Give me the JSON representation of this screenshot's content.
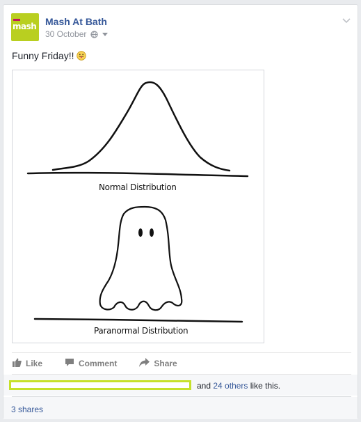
{
  "post": {
    "page_name": "Mash At Bath",
    "date": "30 October",
    "avatar_text": "mash",
    "text": "Funny Friday!!",
    "emoji": "tongue-out-emoji",
    "image": {
      "caption_top": "Normal Distribution",
      "caption_bottom": "Paranormal Distribution"
    }
  },
  "actions": {
    "like": "Like",
    "comment": "Comment",
    "share": "Share"
  },
  "likes": {
    "and_text": "and",
    "others_link": "24 others",
    "suffix": "like this."
  },
  "shares": {
    "label": "3 shares"
  },
  "colors": {
    "link": "#365899",
    "redaction_border": "#c6e12a",
    "avatar_bg": "#b9cf20"
  }
}
